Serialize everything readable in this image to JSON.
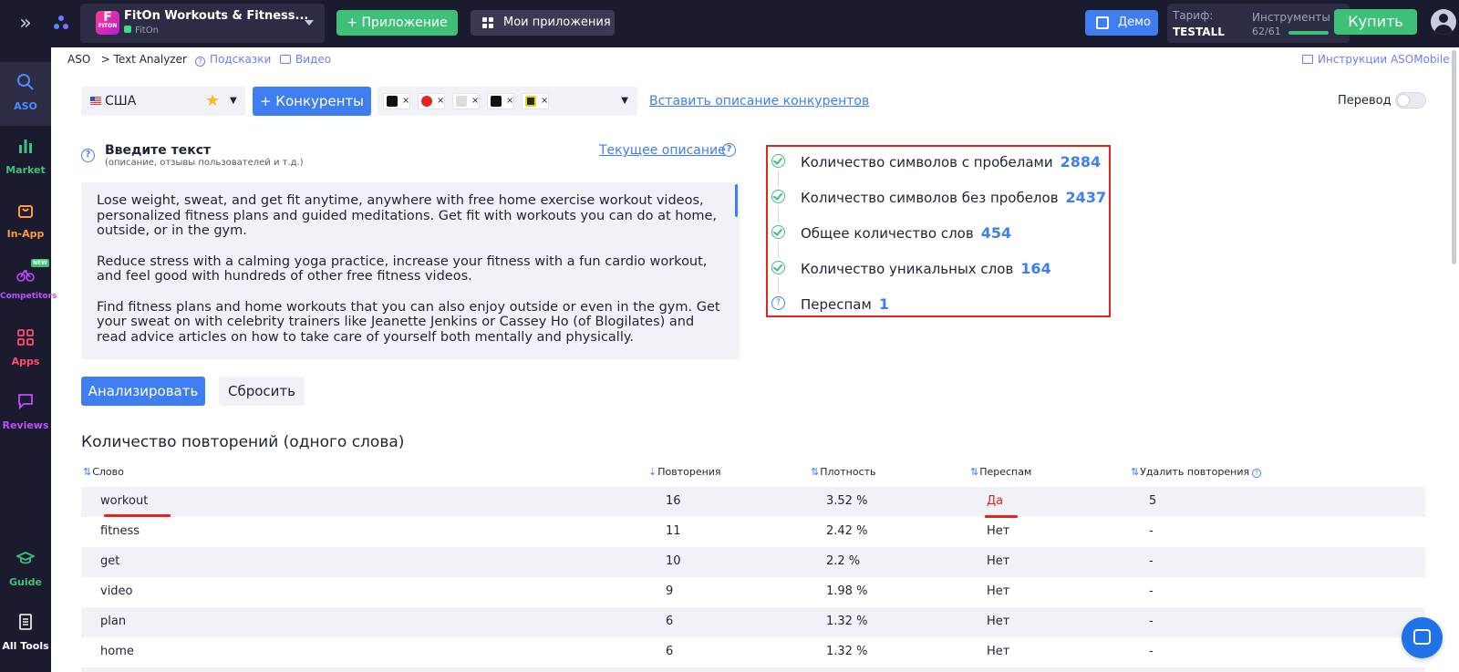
{
  "topbar": {
    "app_title": "FitOn Workouts & Fitness...",
    "app_subtitle": "FitOn",
    "app_icon_text": "FITON",
    "app_icon_letter": "F",
    "add_app_label": "+ Приложение",
    "my_apps_label": "Мои приложения",
    "demo_label": "Демо",
    "tariff_label": "Тариф:",
    "tariff_value": "TESTALL",
    "tools_label": "Инструменты",
    "tools_count": "62/61",
    "buy_label": "Купить"
  },
  "sidebar": {
    "items": [
      {
        "label": "ASO",
        "icon": "search-icon",
        "color": "#4c8dff"
      },
      {
        "label": "Market",
        "icon": "bar-chart-icon",
        "color": "#3fc078"
      },
      {
        "label": "In-App",
        "icon": "shopping-bag-icon",
        "color": "#ff9a3c"
      },
      {
        "label": "Competitors",
        "icon": "bicycle-icon",
        "color": "#c34cff",
        "badge": "NEW"
      },
      {
        "label": "Apps",
        "icon": "grid-icon",
        "color": "#ff4d6d"
      },
      {
        "label": "Reviews",
        "icon": "chat-icon",
        "color": "#c34cff"
      },
      {
        "label": "Guide",
        "icon": "graduation-cap-icon",
        "color": "#3fc078"
      },
      {
        "label": "All Tools",
        "icon": "list-icon",
        "color": "#ffffff"
      }
    ]
  },
  "breadcrumb": {
    "root": "ASO",
    "current": "> Text Analyzer",
    "hints": "Подсказки",
    "video": "Видео",
    "instructions": "Инструкции ASOMobile"
  },
  "controls": {
    "country": "США",
    "competitors_button": "+ Конкуренты",
    "paste_link": "Вставить описание конкурентов",
    "translate_label": "Перевод",
    "competitor_icons": [
      "sweat-app-icon",
      "heart-app-icon",
      "app-icon-3",
      "app-icon-4",
      "app-icon-5"
    ]
  },
  "input": {
    "title": "Введите текст",
    "subtitle": "(описание, отзывы пользователей и т.д.)",
    "current_desc_link": "Текущее описание",
    "paragraphs": [
      "Lose weight, sweat, and get fit anytime, anywhere with free home exercise workout videos, personalized fitness plans and guided meditations. Get fit with workouts you can do at home, outside, or in the gym.",
      "Reduce stress with a calming yoga practice, increase your fitness with a fun cardio workout, and feel good with hundreds of other free fitness videos.",
      "Find fitness plans and home workouts that you can also enjoy outside or even in the gym. Get your sweat on with celebrity trainers like Jeanette Jenkins or Cassey Ho (of Blogilates) and read advice articles on how to take care of yourself both mentally and physically."
    ]
  },
  "stats": [
    {
      "label": "Количество символов с пробелами",
      "value": "2884",
      "status": "ok"
    },
    {
      "label": "Количество символов без пробелов",
      "value": "2437",
      "status": "ok"
    },
    {
      "label": "Общее количество слов",
      "value": "454",
      "status": "ok"
    },
    {
      "label": "Количество уникальных слов",
      "value": "164",
      "status": "ok"
    },
    {
      "label": "Переспам",
      "value": "1",
      "status": "info"
    }
  ],
  "actions": {
    "analyze": "Анализировать",
    "reset": "Сбросить"
  },
  "table": {
    "title": "Количество повторений (одного слова)",
    "columns": [
      "Слово",
      "Повторения",
      "Плотность",
      "Переспам",
      "Удалить повторения"
    ],
    "rows": [
      {
        "word": "workout",
        "count": "16",
        "density": "3.52 %",
        "spam": "Да",
        "remove": "5"
      },
      {
        "word": "fitness",
        "count": "11",
        "density": "2.42 %",
        "spam": "Нет",
        "remove": "-"
      },
      {
        "word": "get",
        "count": "10",
        "density": "2.2 %",
        "spam": "Нет",
        "remove": "-"
      },
      {
        "word": "video",
        "count": "9",
        "density": "1.98 %",
        "spam": "Нет",
        "remove": "-"
      },
      {
        "word": "plan",
        "count": "6",
        "density": "1.32 %",
        "spam": "Нет",
        "remove": "-"
      },
      {
        "word": "home",
        "count": "6",
        "density": "1.32 %",
        "spam": "Нет",
        "remove": "-"
      }
    ]
  },
  "colors": {
    "accent": "#3f7ef0",
    "green": "#3fc078",
    "highlight_red": "#e52420",
    "dark_bg": "#1b1b2f"
  }
}
